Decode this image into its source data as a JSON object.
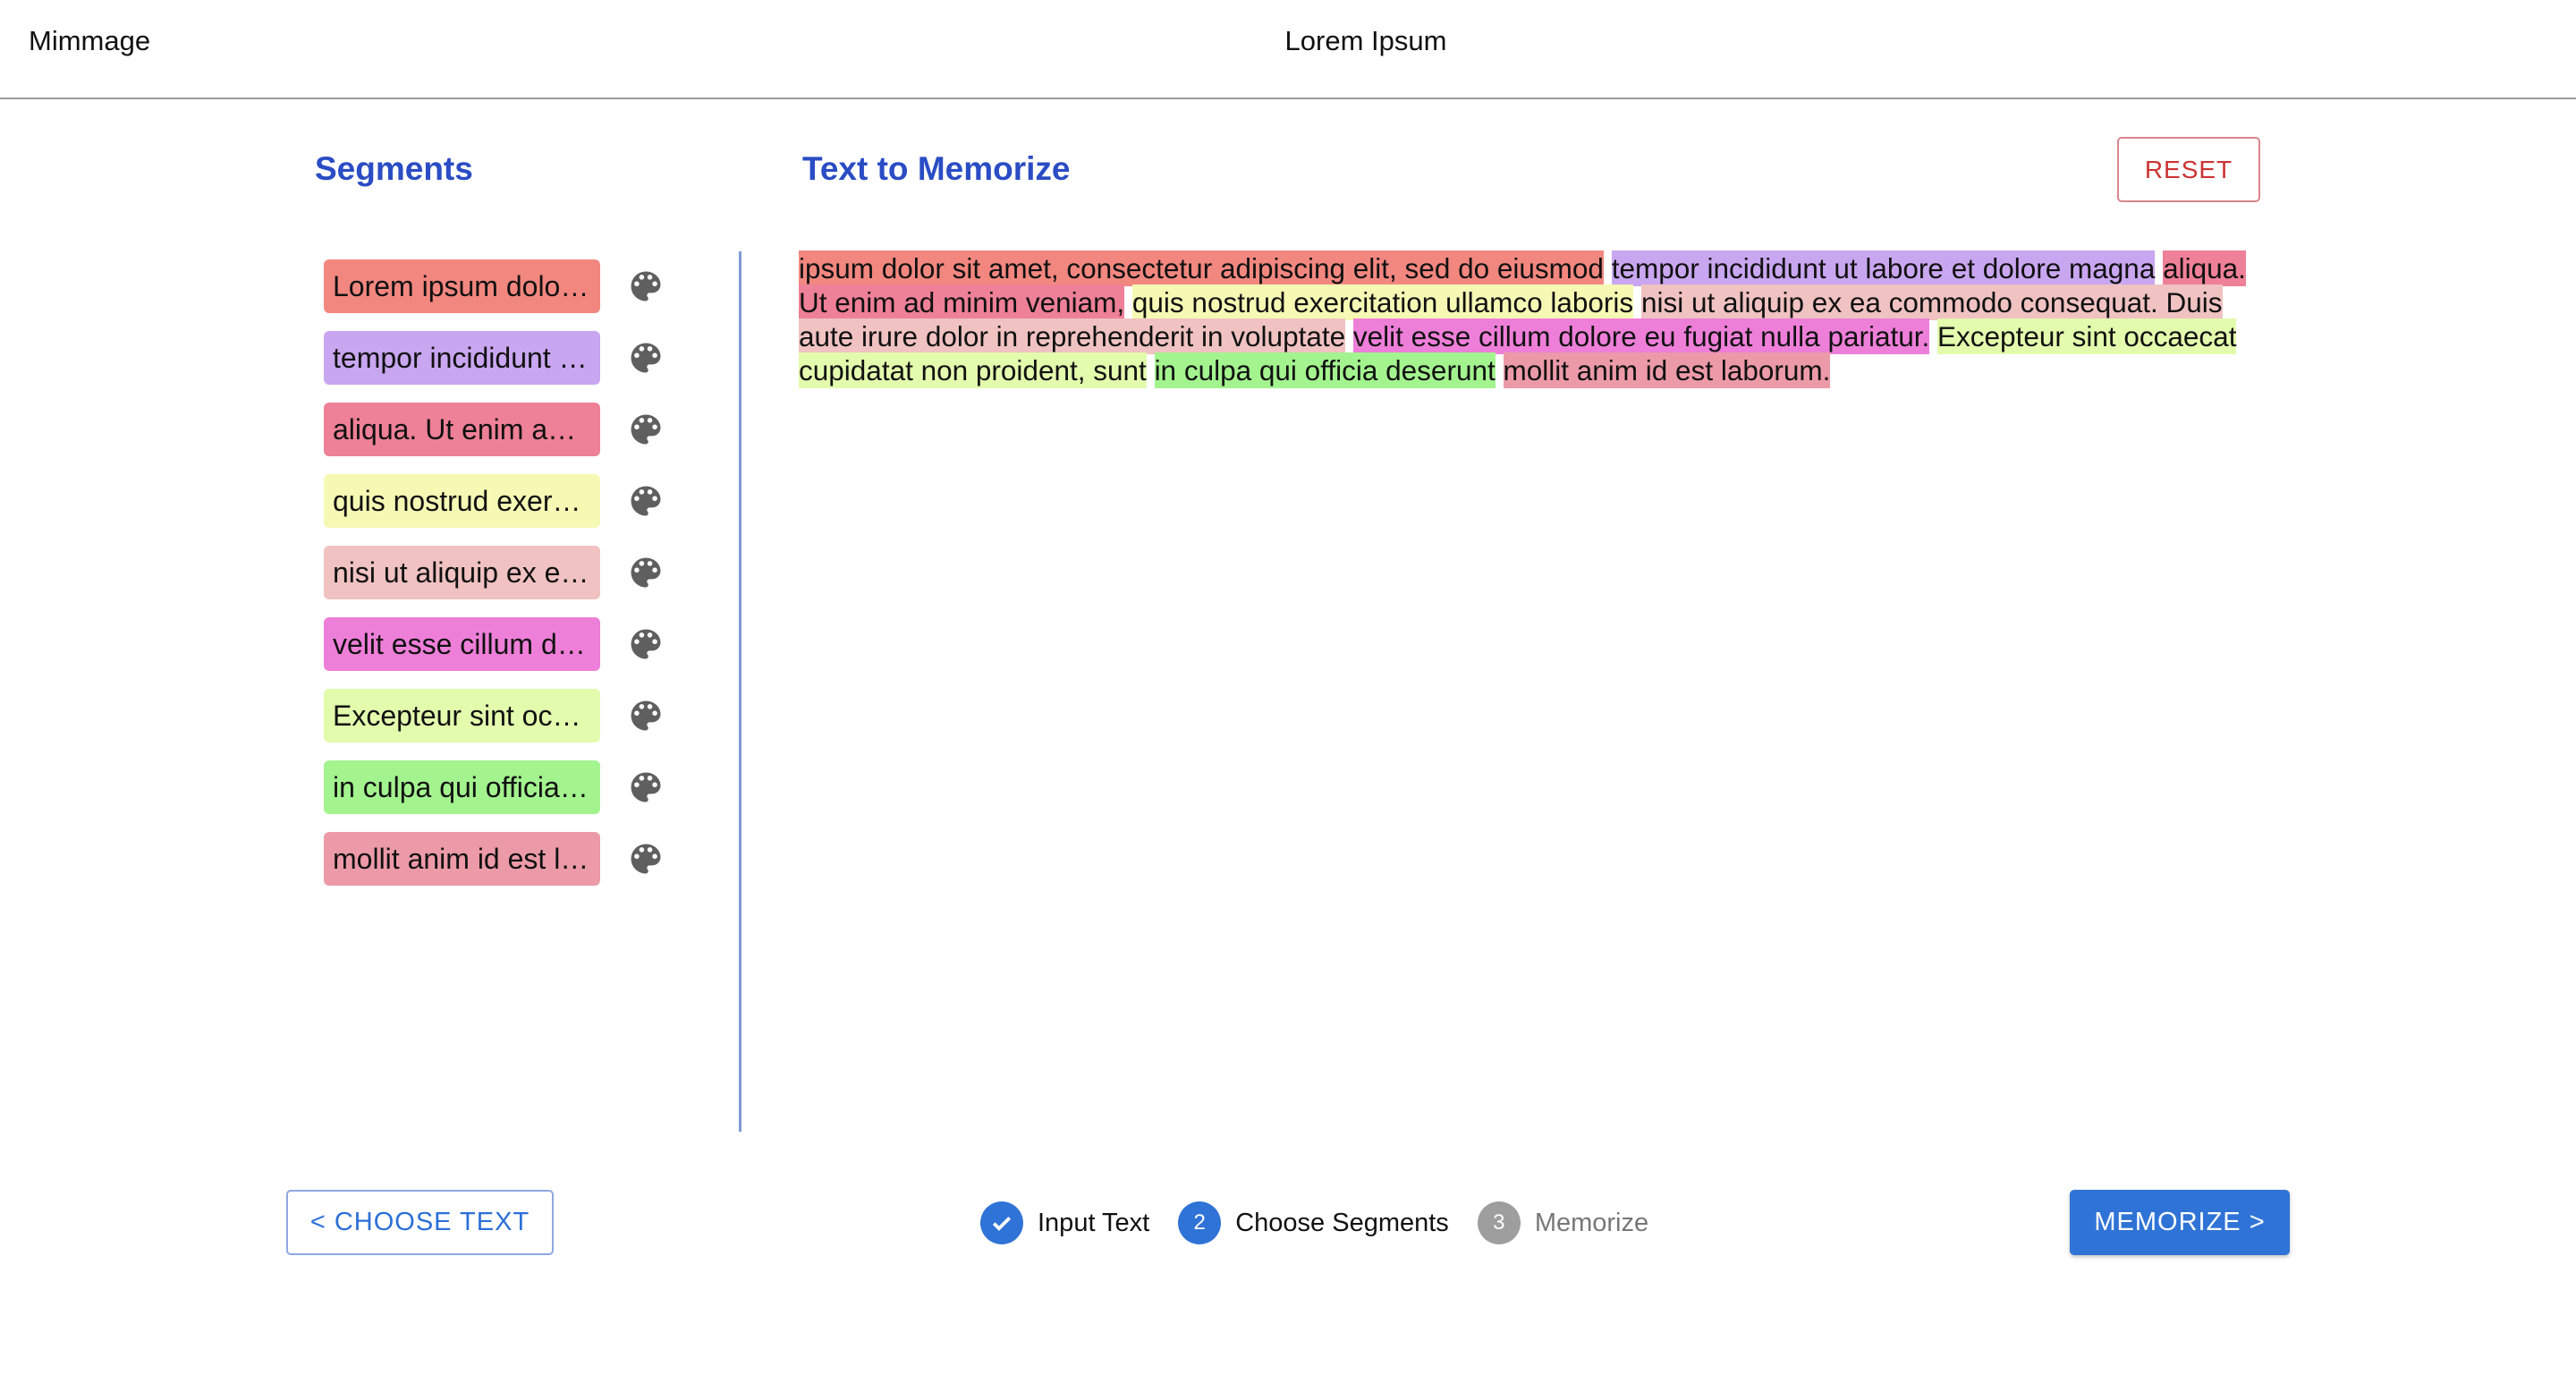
{
  "header": {
    "app_name": "Mimmage",
    "doc_title": "Lorem Ipsum"
  },
  "segments_panel": {
    "title": "Segments",
    "items": [
      {
        "label": "Lorem ipsum dolor sit amet, consectetur adipiscing elit, sed do eiusmod",
        "color": "#f2877f",
        "icon": "palette-icon"
      },
      {
        "label": "tempor incididunt ut labore et dolore magna",
        "color": "#c9a6f0",
        "icon": "palette-icon"
      },
      {
        "label": "aliqua. Ut enim ad minim veniam,",
        "color": "#ee8097",
        "icon": "palette-icon"
      },
      {
        "label": "quis nostrud exercitation ullamco laboris",
        "color": "#f6f9b4",
        "icon": "palette-icon"
      },
      {
        "label": "nisi ut aliquip ex ea commodo consequat. Duis aute irure dolor in reprehenderit in voluptate",
        "color": "#f0c2c2",
        "icon": "palette-icon"
      },
      {
        "label": "velit esse cillum dolore eu fugiat nulla pariatur.",
        "color": "#ee7fd9",
        "icon": "palette-icon"
      },
      {
        "label": "Excepteur sint occaecat cupidatat non proident, sunt",
        "color": "#e3fbad",
        "icon": "palette-icon"
      },
      {
        "label": "in culpa qui officia deserunt",
        "color": "#a3f38e",
        "icon": "palette-icon"
      },
      {
        "label": "mollit anim id est laborum.",
        "color": "#ec9aa8",
        "icon": "palette-icon"
      }
    ]
  },
  "memorize_panel": {
    "title": "Text to Memorize",
    "reset_label": "RESET",
    "text_segments": [
      {
        "text": "ipsum dolor sit amet, consectetur adipiscing elit, sed do eiusmod",
        "color": "#f2877f"
      },
      {
        "text": "tempor incididunt ut labore et dolore magna",
        "color": "#c9a6f0"
      },
      {
        "text": "aliqua. Ut enim ad minim veniam,",
        "color": "#ee8097"
      },
      {
        "text": "quis nostrud exercitation ullamco laboris",
        "color": "#f6f9b4"
      },
      {
        "text": "nisi ut aliquip ex ea commodo consequat. Duis aute irure dolor in reprehenderit in voluptate",
        "color": "#f0c2c2"
      },
      {
        "text": "velit esse cillum dolore eu fugiat nulla pariatur.",
        "color": "#ee7fd9"
      },
      {
        "text": "Excepteur sint occaecat cupidatat non proident, sunt",
        "color": "#e3fbad"
      },
      {
        "text": "in culpa qui officia deserunt",
        "color": "#a3f38e"
      },
      {
        "text": "mollit anim id est laborum.",
        "color": "#ec9aa8"
      }
    ]
  },
  "footer": {
    "back_label": "< CHOOSE TEXT",
    "next_label": "MEMORIZE >",
    "steps": [
      {
        "number": "",
        "label": "Input Text",
        "state": "completed",
        "color": "#2f73d6"
      },
      {
        "number": "2",
        "label": "Choose Segments",
        "state": "active",
        "color": "#2f73d6"
      },
      {
        "number": "3",
        "label": "Memorize",
        "state": "inactive",
        "color": "#9e9e9e"
      }
    ]
  }
}
